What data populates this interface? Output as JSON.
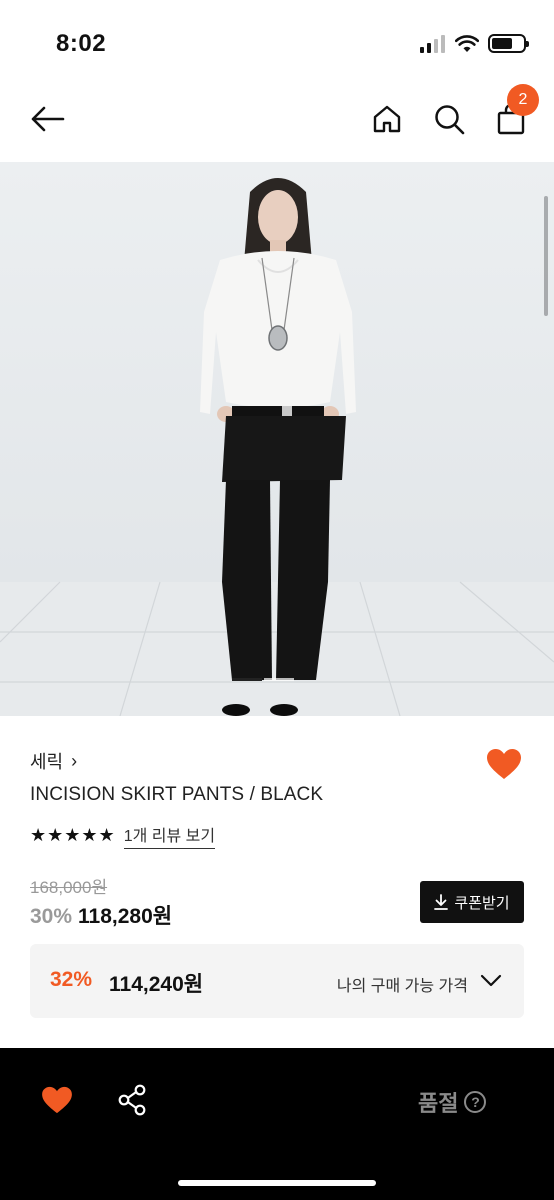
{
  "status": {
    "time": "8:02"
  },
  "nav": {
    "cart_count": "2"
  },
  "product": {
    "brand": "세릭",
    "brand_chevron": "›",
    "name": "INCISION SKIRT PANTS / BLACK",
    "rating_stars": "★★★★★",
    "review_link": "1개 리뷰 보기",
    "original_price": "168,000원",
    "discount_rate": "30%",
    "sale_price": "118,280원",
    "coupon_label": "쿠폰받기"
  },
  "my_price": {
    "discount_rate": "32%",
    "price": "114,240원",
    "label": "나의 구매 가능 가격"
  },
  "bottom": {
    "soldout_label": "품절",
    "help_symbol": "?"
  },
  "colors": {
    "accent": "#f15a23",
    "background": "#ffffff",
    "bottom_bar": "#000000"
  },
  "icons": {
    "back": "arrow-left-icon",
    "home": "home-icon",
    "search": "search-icon",
    "cart": "shopping-bag-icon",
    "like": "heart-icon",
    "share": "share-icon",
    "download": "download-icon",
    "chevron": "chevron-down-icon",
    "help": "question-circle-icon"
  }
}
